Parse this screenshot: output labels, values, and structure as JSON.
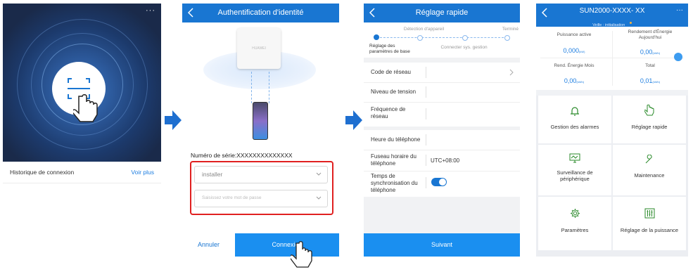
{
  "screen1": {
    "menu_icon": "more-dots-icon",
    "history_label": "Historique de connexion",
    "see_more_label": "Voir plus"
  },
  "screen2": {
    "title": "Authentification d'identité",
    "device_logo": "HUAWEI",
    "serial_label": "Numéro de série:XXXXXXXXXXXXXX",
    "username_value": "installer",
    "password_placeholder": "Saisissez votre mot de passe",
    "cancel_label": "Annuler",
    "login_label": "Connexion"
  },
  "screen3": {
    "title": "Réglage rapide",
    "steps": [
      {
        "label": "Réglage des paramètres de base"
      },
      {
        "label": "Détection d'appareil"
      },
      {
        "label": "Connecter sys. gestion"
      },
      {
        "label": "Terminé"
      }
    ],
    "fields_group1": [
      {
        "label": "Code de réseau",
        "value": ""
      },
      {
        "label": "Niveau de tension",
        "value": ""
      },
      {
        "label": "Fréquence de réseau",
        "value": ""
      }
    ],
    "fields_group2": [
      {
        "label": "Heure du téléphone",
        "value": ""
      },
      {
        "label": "Fuseau horaire du téléphone",
        "value": "UTC+08:00"
      },
      {
        "label": "Temps de synchronisation du téléphone",
        "value": ""
      }
    ],
    "next_label": "Suivant"
  },
  "screen4": {
    "title": "SUN2000-XXXX- XX",
    "status": "Veille : initialisation",
    "stats": [
      {
        "label": "Puissance active",
        "value": "0,000",
        "unit": "(kW)"
      },
      {
        "label": "Rendement d'Énergie Aujourd'hui",
        "value": "0,00",
        "unit": "(kWh)"
      },
      {
        "label": "Rend. Énergie Mois",
        "value": "0,00",
        "unit": "(kWh)"
      },
      {
        "label": "Total",
        "value": "0,01",
        "unit": "(kWh)"
      }
    ],
    "menu": [
      {
        "label": "Gestion des alarmes",
        "icon": "alarm-bell-icon"
      },
      {
        "label": "Réglage rapide",
        "icon": "tap-hand-icon"
      },
      {
        "label": "Surveillance de périphérique",
        "icon": "monitor-icon"
      },
      {
        "label": "Maintenance",
        "icon": "wrench-icon"
      },
      {
        "label": "Paramètres",
        "icon": "gear-icon"
      },
      {
        "label": "Réglage de la puissance",
        "icon": "power-adjust-icon"
      }
    ]
  },
  "colors": {
    "primary": "#1976d2",
    "highlight": "#e02020",
    "dark_bg": "#1a2a4a",
    "value_blue": "#1c7de0"
  }
}
